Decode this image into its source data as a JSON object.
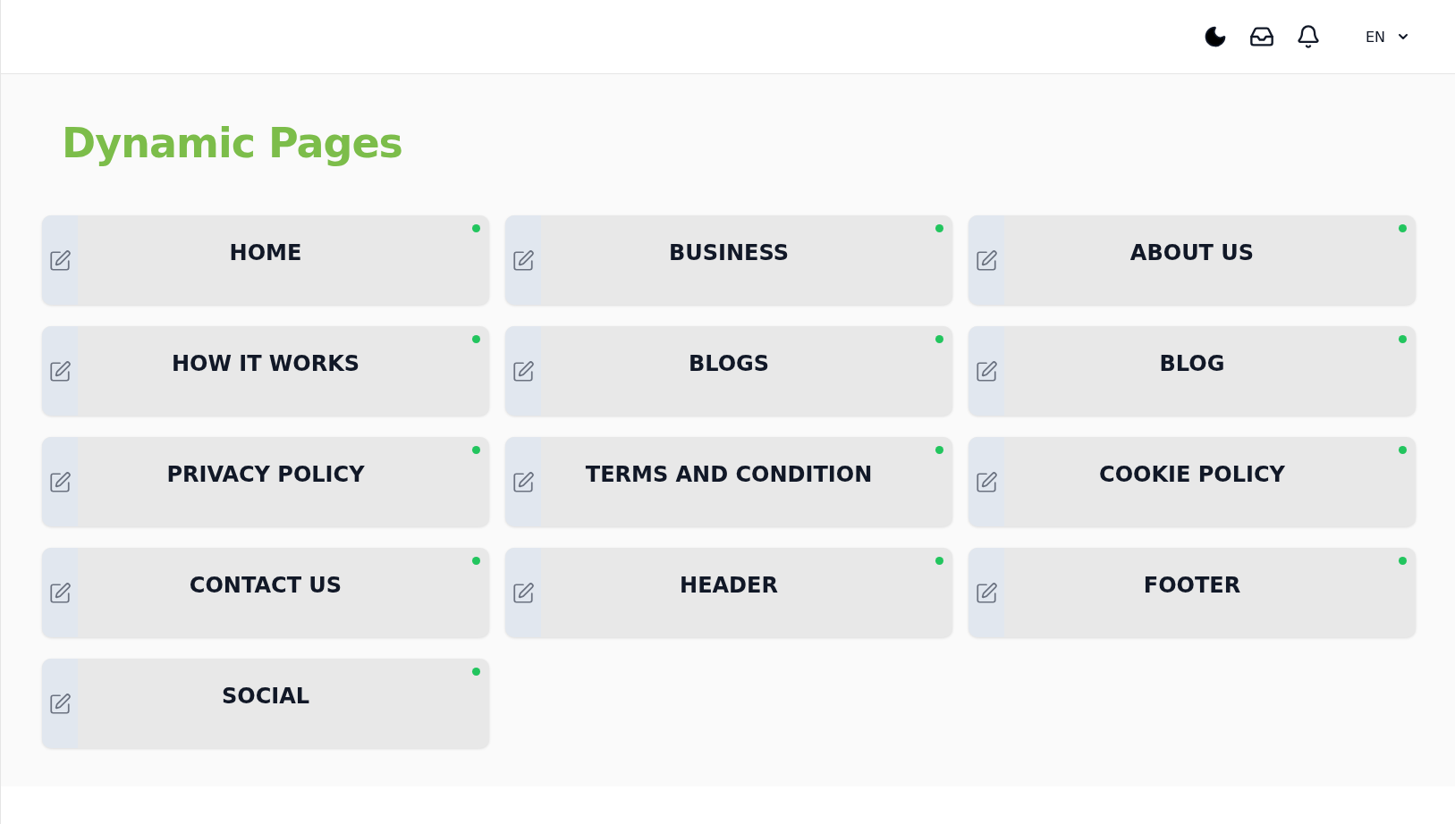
{
  "header": {
    "language": "EN"
  },
  "title": "Dynamic Pages",
  "pages": [
    {
      "label": "HOME",
      "active": true
    },
    {
      "label": "BUSINESS",
      "active": true
    },
    {
      "label": "ABOUT US",
      "active": true
    },
    {
      "label": "HOW IT WORKS",
      "active": true
    },
    {
      "label": "BLOGS",
      "active": true
    },
    {
      "label": "BLOG",
      "active": true
    },
    {
      "label": "PRIVACY POLICY",
      "active": true
    },
    {
      "label": "TERMS AND CONDITION",
      "active": true
    },
    {
      "label": "COOKIE POLICY",
      "active": true
    },
    {
      "label": "CONTACT US",
      "active": true
    },
    {
      "label": "HEADER",
      "active": true
    },
    {
      "label": "FOOTER",
      "active": true
    },
    {
      "label": "SOCIAL",
      "active": true
    }
  ]
}
